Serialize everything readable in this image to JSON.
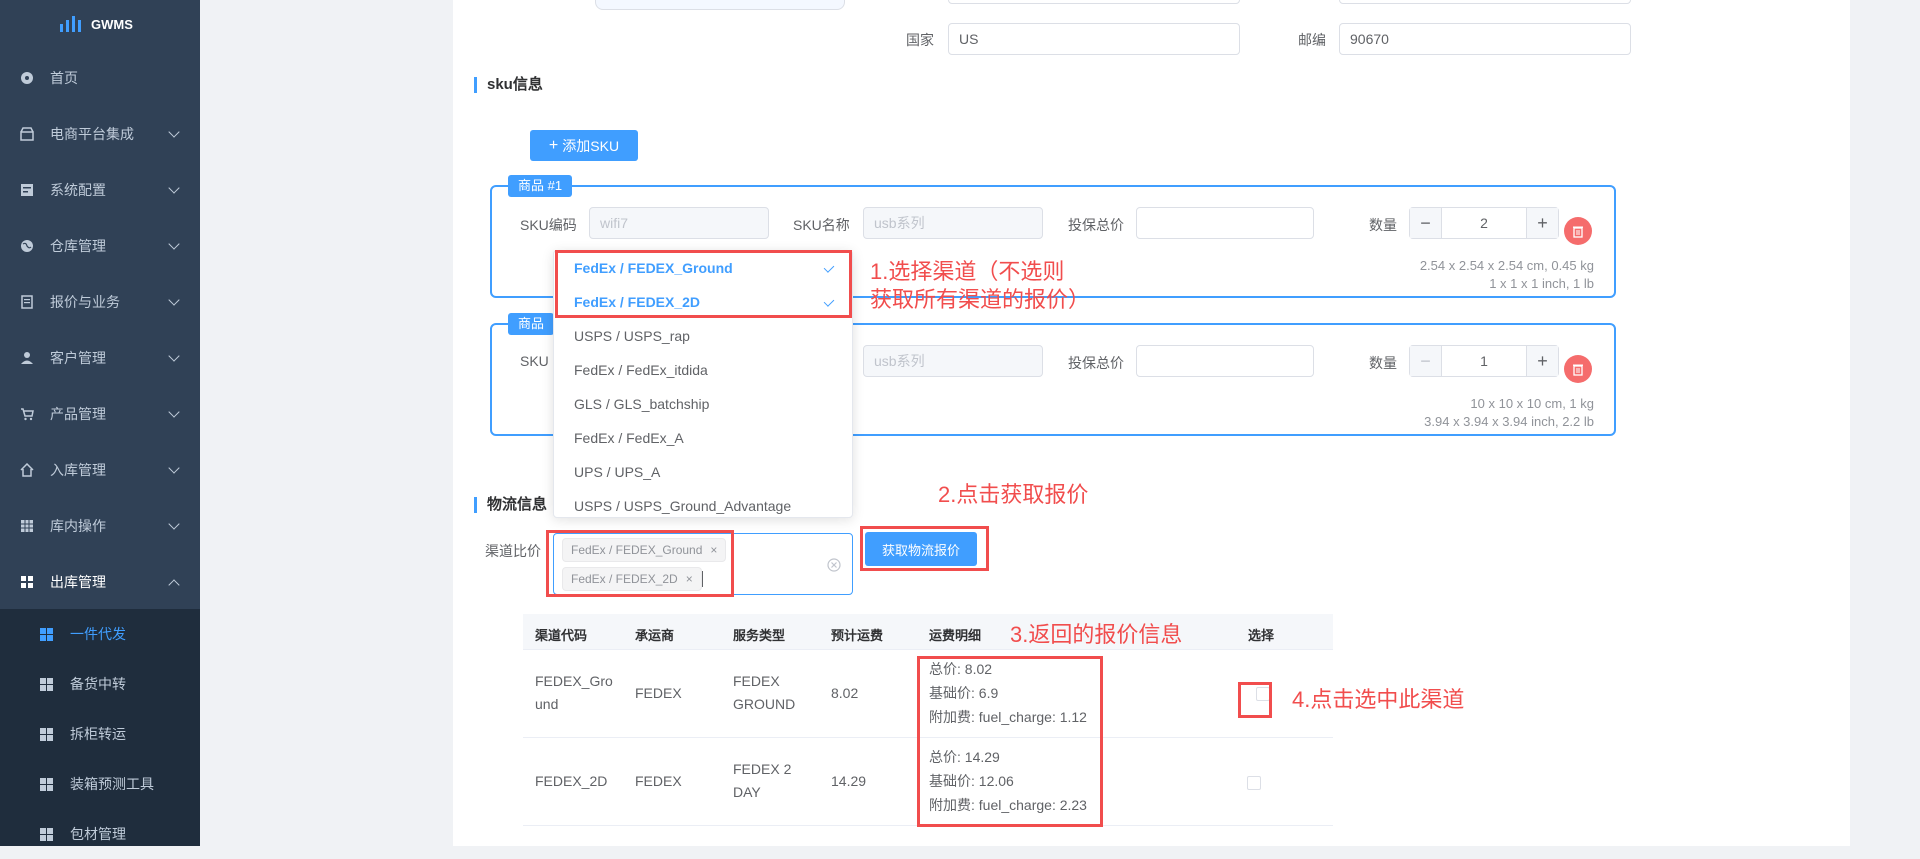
{
  "app": {
    "name": "GWMS"
  },
  "sidebar": {
    "items": [
      {
        "label": "首页",
        "icon": "dashboard-icon"
      },
      {
        "label": "电商平台集成",
        "icon": "store-icon"
      },
      {
        "label": "系统配置",
        "icon": "config-icon"
      },
      {
        "label": "仓库管理",
        "icon": "globe-icon"
      },
      {
        "label": "报价与业务",
        "icon": "document-icon"
      },
      {
        "label": "客户管理",
        "icon": "user-icon"
      },
      {
        "label": "产品管理",
        "icon": "cart-icon"
      },
      {
        "label": "入库管理",
        "icon": "home-icon"
      },
      {
        "label": "库内操作",
        "icon": "table-icon"
      },
      {
        "label": "出库管理",
        "icon": "grid-icon"
      }
    ],
    "subitems": [
      {
        "label": "一件代发",
        "active": true
      },
      {
        "label": "备货中转"
      },
      {
        "label": "拆柜转运"
      },
      {
        "label": "装箱预测工具"
      },
      {
        "label": "包材管理"
      }
    ]
  },
  "address": {
    "country_label": "国家",
    "country_value": "US",
    "zip_label": "邮编",
    "zip_value": "90670"
  },
  "sku_section": {
    "title": "sku信息",
    "add_button": "添加SKU",
    "products": [
      {
        "tag": "商品 #1",
        "sku_code_label": "SKU编码",
        "sku_code_value": "wifi7",
        "sku_name_label": "SKU名称",
        "sku_name_value": "usb系列",
        "insured_label": "投保总价",
        "insured_value": "",
        "qty_label": "数量",
        "qty_value": "2",
        "dims_metric": "2.54 x 2.54 x 2.54 cm, 0.45 kg",
        "dims_imperial": "1 x 1 x 1 inch, 1 lb"
      },
      {
        "tag": "商品",
        "sku_code_label": "SKU",
        "sku_name_value": "usb系列",
        "insured_label": "投保总价",
        "insured_value": "",
        "qty_label": "数量",
        "qty_value": "1",
        "dims_metric": "10 x 10 x 10 cm, 1 kg",
        "dims_imperial": "3.94 x 3.94 x 3.94 inch, 2.2 lb"
      }
    ]
  },
  "dropdown": {
    "options": [
      {
        "label": "FedEx / FEDEX_Ground",
        "selected": true
      },
      {
        "label": "FedEx / FEDEX_2D",
        "selected": true
      },
      {
        "label": "USPS / USPS_rap"
      },
      {
        "label": "FedEx / FedEx_itdida"
      },
      {
        "label": "GLS / GLS_batchship"
      },
      {
        "label": "FedEx / FedEx_A"
      },
      {
        "label": "UPS / UPS_A"
      },
      {
        "label": "USPS / USPS_Ground_Advantage"
      }
    ]
  },
  "logistics": {
    "title": "物流信息",
    "channel_label": "渠道比价",
    "tags": [
      "FedEx / FEDEX_Ground",
      "FedEx / FEDEX_2D"
    ],
    "quote_button": "获取物流报价"
  },
  "table": {
    "headers": [
      "渠道代码",
      "承运商",
      "服务类型",
      "预计运费",
      "运费明细",
      "选择"
    ],
    "rows": [
      {
        "code_l1": "FEDEX_Gro",
        "code_l2": "und",
        "carrier": "FEDEX",
        "service_l1": "FEDEX",
        "service_l2": "GROUND",
        "fee": "8.02",
        "detail_total": "总价: 8.02",
        "detail_base": "基础价: 6.9",
        "detail_extra": "附加费: fuel_charge: 1.12"
      },
      {
        "code_l1": "FEDEX_2D",
        "code_l2": "",
        "carrier": "FEDEX",
        "service_l1": "FEDEX 2",
        "service_l2": "DAY",
        "fee": "14.29",
        "detail_total": "总价: 14.29",
        "detail_base": "基础价: 12.06",
        "detail_extra": "附加费: fuel_charge: 2.23"
      }
    ]
  },
  "annotations": {
    "step1_l1": "1.选择渠道（不选则",
    "step1_l2": "获取所有渠道的报价）",
    "step2": "2.点击获取报价",
    "step3": "3.返回的报价信息",
    "step4": "4.点击选中此渠道"
  },
  "colors": {
    "primary": "#409eff",
    "sidebar": "#304156",
    "annotation": "#f14d4d",
    "danger": "#f56c6c"
  }
}
